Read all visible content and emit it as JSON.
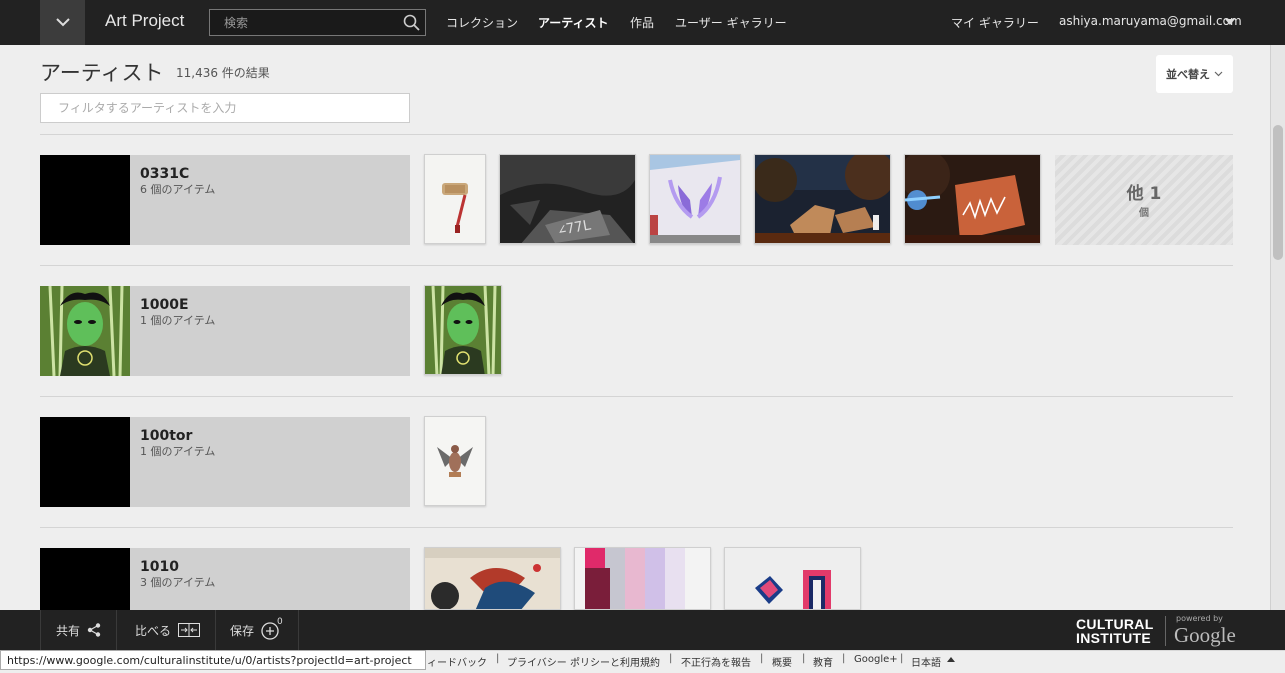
{
  "topbar": {
    "brand": "Art Project",
    "search_placeholder": "検索",
    "nav": [
      "コレクション",
      "アーティスト",
      "作品",
      "ユーザー ギャラリー"
    ],
    "my_gallery": "マイ ギャラリー",
    "user_email": "ashiya.maruyama@gmail.com"
  },
  "header": {
    "title": "アーティスト",
    "result_count": "11,436 件の結果",
    "sort_label": "並べ替え",
    "filter_placeholder": "フィルタするアーティストを入力"
  },
  "artists": [
    {
      "name": "0331C",
      "count": "6 個のアイテム",
      "more_big": "他 1",
      "more_small": "個"
    },
    {
      "name": "1000E",
      "count": "1 個のアイテム"
    },
    {
      "name": "100tor",
      "count": "1 個のアイテム"
    },
    {
      "name": "1010",
      "count": "3 個のアイテム"
    }
  ],
  "bottombar": {
    "share": "共有",
    "compare": "比べる",
    "save": "保存",
    "save_count": "0",
    "logo_line1": "CULTURAL",
    "logo_line2": "INSTITUTE",
    "powered_by": "powered by",
    "google": "Google"
  },
  "footer": {
    "status_url": "https://www.google.com/culturalinstitute/u/0/artists?projectId=art-project",
    "links": [
      "ィードバック",
      "プライバシー ポリシーと利用規約",
      "不正行為を報告",
      "概要",
      "教育",
      "Google+",
      "日本語"
    ]
  },
  "colors": {
    "topbar_bg": "#222222",
    "page_bg": "#eeeeee",
    "card_bg": "#d0d0d0"
  }
}
